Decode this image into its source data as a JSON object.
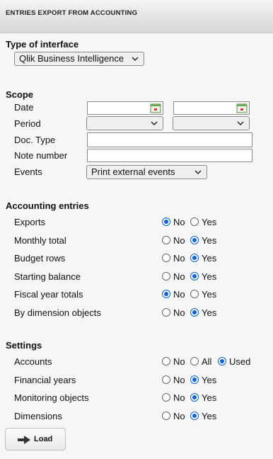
{
  "header": {
    "title": "ENTRIES EXPORT FROM ACCOUNTING"
  },
  "interface": {
    "section_title": "Type of interface",
    "selected": "Qlik Business Intelligence"
  },
  "scope": {
    "section_title": "Scope",
    "date_label": "Date",
    "period_label": "Period",
    "doctype_label": "Doc. Type",
    "note_label": "Note number",
    "events_label": "Events",
    "events_selected": "Print external events"
  },
  "accounting": {
    "section_title": "Accounting entries",
    "rows": [
      {
        "label": "Exports",
        "options": [
          "No",
          "Yes"
        ],
        "selected": "No"
      },
      {
        "label": "Monthly total",
        "options": [
          "No",
          "Yes"
        ],
        "selected": "Yes"
      },
      {
        "label": "Budget rows",
        "options": [
          "No",
          "Yes"
        ],
        "selected": "Yes"
      },
      {
        "label": "Starting balance",
        "options": [
          "No",
          "Yes"
        ],
        "selected": "Yes"
      },
      {
        "label": "Fiscal year totals",
        "options": [
          "No",
          "Yes"
        ],
        "selected": "No"
      },
      {
        "label": "By dimension objects",
        "options": [
          "No",
          "Yes"
        ],
        "selected": "Yes"
      }
    ]
  },
  "settings": {
    "section_title": "Settings",
    "rows": [
      {
        "label": "Accounts",
        "options": [
          "No",
          "All",
          "Used"
        ],
        "selected": "Used"
      },
      {
        "label": "Financial years",
        "options": [
          "No",
          "Yes"
        ],
        "selected": "Yes"
      },
      {
        "label": "Monitoring objects",
        "options": [
          "No",
          "Yes"
        ],
        "selected": "Yes"
      },
      {
        "label": "Dimensions",
        "options": [
          "No",
          "Yes"
        ],
        "selected": "Yes"
      }
    ]
  },
  "load_button": {
    "label": "Load",
    "icon": "arrow-right-icon"
  },
  "colors": {
    "radio_selected": "#0b63d6",
    "header_bg": "#dcdcdc"
  }
}
